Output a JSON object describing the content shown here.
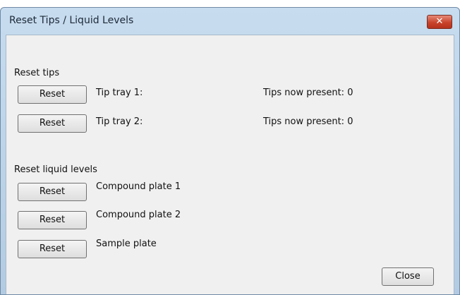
{
  "window": {
    "title": "Reset Tips / Liquid Levels",
    "close_glyph": "✕"
  },
  "tips": {
    "section_label": "Reset tips",
    "rows": [
      {
        "button": "Reset",
        "label": "Tip tray 1:",
        "status": "Tips now present: 0"
      },
      {
        "button": "Reset",
        "label": "Tip tray 2:",
        "status": "Tips now present: 0"
      }
    ]
  },
  "liquid": {
    "section_label": "Reset liquid levels",
    "rows": [
      {
        "button": "Reset",
        "label": "Compound plate 1"
      },
      {
        "button": "Reset",
        "label": "Compound plate 2"
      },
      {
        "button": "Reset",
        "label": "Sample plate"
      }
    ]
  },
  "footer": {
    "close_label": "Close"
  }
}
